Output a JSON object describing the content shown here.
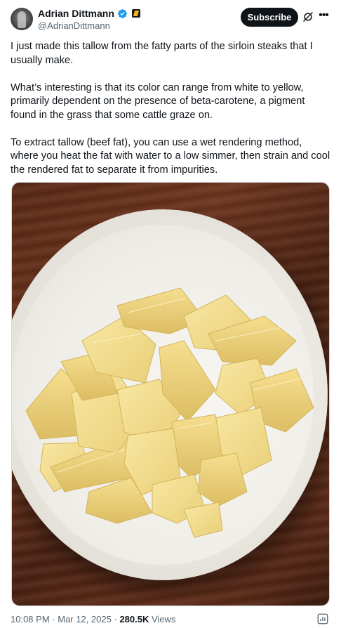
{
  "author": {
    "display_name": "Adrian Dittmann",
    "handle": "@AdrianDittmann"
  },
  "header": {
    "subscribe_label": "Subscribe"
  },
  "tweet": {
    "paragraphs": [
      "I just made this tallow from the fatty parts of the sirloin steaks that I usually make.",
      "What’s interesting is that its color can range from white to yellow, primarily dependent on the presence of beta-carotene, a pigment found in the grass that some cattle graze on.",
      "To extract tallow (beef fat), you can use a wet rendering method, where you heat the fat with water to a low simmer, then strain and cool the rendered fat to separate it from impurities."
    ]
  },
  "footer": {
    "time": "10:08 PM",
    "separator": "·",
    "date": "Mar 12, 2025",
    "views_count": "280.5K",
    "views_label": "Views"
  },
  "colors": {
    "verified_blue": "#1d9bf0",
    "text_primary": "#0f1419",
    "text_secondary": "#536471",
    "tallow_yellow": "#f2dc8a"
  },
  "icons": [
    "verified-badge-icon",
    "affiliate-badge-icon",
    "grok-icon",
    "more-icon",
    "analytics-icon"
  ]
}
